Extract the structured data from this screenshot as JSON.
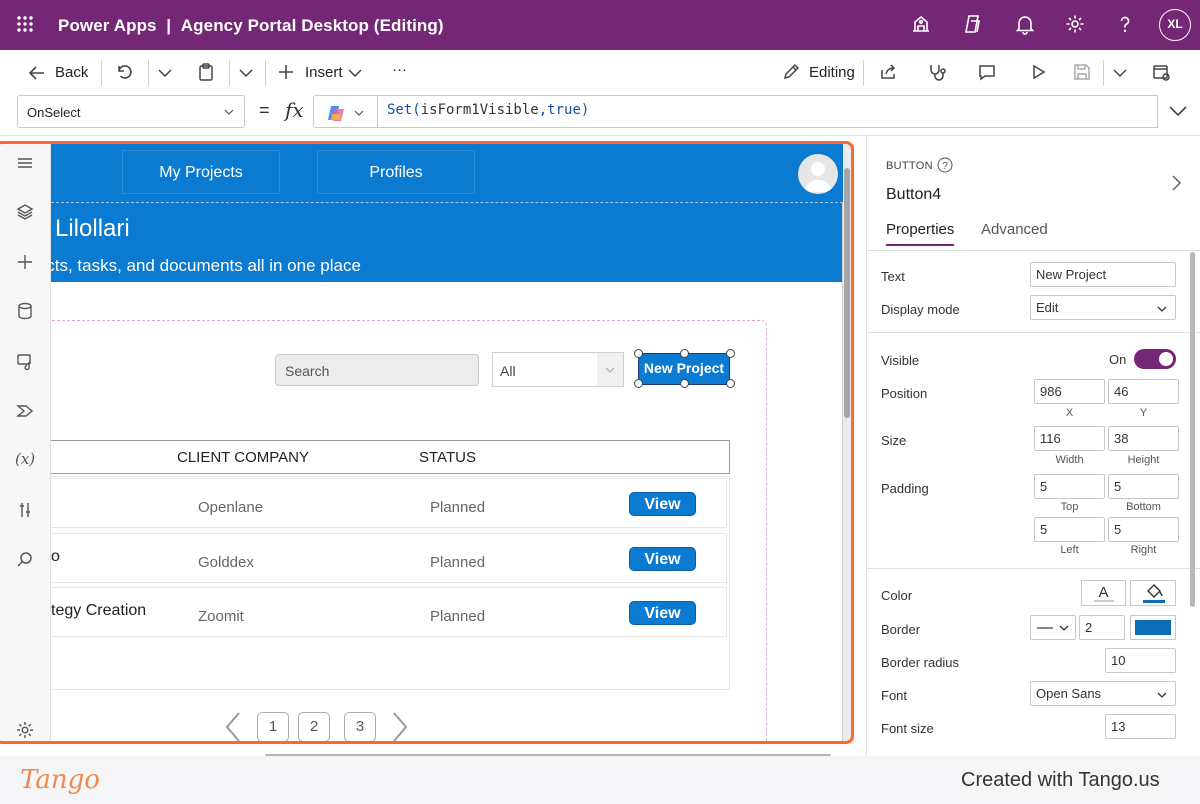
{
  "app": {
    "title": "Power Apps",
    "separator": "|",
    "project": "Agency Portal Desktop (Editing)",
    "user_initials": "XL"
  },
  "toolbar": {
    "back_label": "Back",
    "insert_label": "Insert",
    "more_label": "···",
    "editing_label": "Editing"
  },
  "formula_bar": {
    "property": "OnSelect",
    "equals": "=",
    "fx": "fx",
    "formula_fn": "Set(",
    "formula_var": "isForm1Visible",
    "formula_comma": ",",
    "formula_value": "true",
    "formula_close": ")"
  },
  "screen": {
    "nav_tabs": [
      "My Projects",
      "Profiles"
    ],
    "greeting": "Lilollari",
    "subtitle": "jects, tasks, and documents all in one place",
    "search_placeholder": "Search",
    "filter_value": "All",
    "new_project_label": "New Project",
    "columns": [
      "CLIENT COMPANY",
      "STATUS"
    ],
    "rows": [
      {
        "name": "",
        "company": "Openlane",
        "status": "Planned",
        "action": "View"
      },
      {
        "name": "o",
        "company": "Golddex",
        "status": "Planned",
        "action": "View"
      },
      {
        "name": "tegy Creation",
        "company": "Zoomit",
        "status": "Planned",
        "action": "View"
      }
    ],
    "pages": [
      "1",
      "2",
      "3"
    ]
  },
  "properties": {
    "control_type": "BUTTON",
    "control_name": "Button4",
    "tabs": [
      "Properties",
      "Advanced"
    ],
    "text_label": "Text",
    "text_value": "New Project",
    "display_mode_label": "Display mode",
    "display_mode_value": "Edit",
    "visible_label": "Visible",
    "visible_value": "On",
    "position_label": "Position",
    "position_x": "986",
    "position_y": "46",
    "x_caption": "X",
    "y_caption": "Y",
    "size_label": "Size",
    "size_width": "116",
    "size_height": "38",
    "width_caption": "Width",
    "height_caption": "Height",
    "padding_label": "Padding",
    "padding_top": "5",
    "padding_bottom": "5",
    "padding_left": "5",
    "padding_right": "5",
    "top_caption": "Top",
    "bottom_caption": "Bottom",
    "left_caption": "Left",
    "right_caption": "Right",
    "color_label": "Color",
    "color_text_glyph": "A",
    "border_label": "Border",
    "border_width": "2",
    "border_color": "#0b6cb8",
    "border_radius_label": "Border radius",
    "border_radius_value": "10",
    "font_label": "Font",
    "font_value": "Open Sans",
    "font_size_label": "Font size",
    "font_size_value": "13"
  },
  "footer": {
    "brand": "Tango",
    "credit": "Created with Tango.us"
  },
  "colors": {
    "header_purple": "#742774",
    "app_blue": "#0b7ad1",
    "selection_orange": "#ff6633",
    "toggle_purple": "#742774"
  }
}
